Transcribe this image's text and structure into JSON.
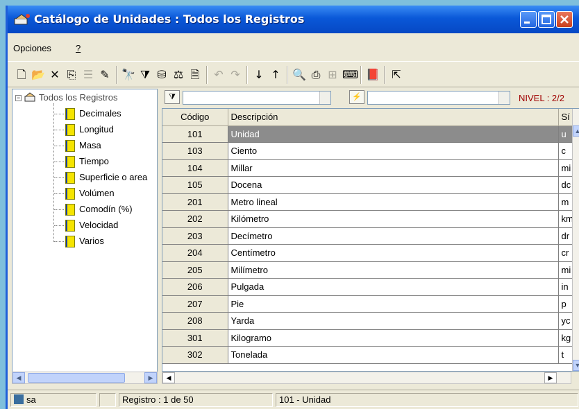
{
  "window": {
    "title": "Catálogo de Unidades  :   Todos los Registros"
  },
  "menu": {
    "items": [
      "Opciones",
      "?"
    ]
  },
  "toolbar": {
    "tools": [
      {
        "name": "new-icon",
        "glyph": "🗋"
      },
      {
        "name": "open-folder-icon",
        "glyph": "📂"
      },
      {
        "name": "delete-icon",
        "glyph": "✕"
      },
      {
        "name": "copy-icon",
        "glyph": "⎘"
      },
      {
        "name": "columns-icon",
        "glyph": "☰"
      },
      {
        "name": "edit-icon",
        "glyph": "✎"
      },
      {
        "name": "find-icon",
        "glyph": "🔭"
      },
      {
        "name": "filter-icon",
        "glyph": "⧩"
      },
      {
        "name": "group-icon",
        "glyph": "⛁"
      },
      {
        "name": "units-icon",
        "glyph": "⚖"
      },
      {
        "name": "properties-icon",
        "glyph": "🗎"
      },
      {
        "name": "undo-icon",
        "glyph": "↶"
      },
      {
        "name": "redo-icon",
        "glyph": "↷"
      },
      {
        "name": "sort-ascending-icon",
        "glyph": "↓"
      },
      {
        "name": "sort-descending-icon",
        "glyph": "↑"
      },
      {
        "name": "print-preview-icon",
        "glyph": "🔍"
      },
      {
        "name": "print-icon",
        "glyph": "⎙"
      },
      {
        "name": "hierarchy-icon",
        "glyph": "⊞"
      },
      {
        "name": "keyboard-icon",
        "glyph": "⌨"
      },
      {
        "name": "book-icon",
        "glyph": "📕"
      },
      {
        "name": "exit-icon",
        "glyph": "⇱"
      }
    ]
  },
  "tree": {
    "root": "Todos los Registros",
    "items": [
      "Decimales",
      "Longitud",
      "Masa",
      "Tiempo",
      "Superficie o area",
      "Volúmen",
      "Comodín (%)",
      "Velocidad",
      "Varios"
    ]
  },
  "filter": {
    "nivel": "NIVEL : 2/2"
  },
  "grid": {
    "headers": {
      "code": "Código",
      "desc": "Descripción",
      "sym": "Sí"
    },
    "rows": [
      {
        "code": "101",
        "desc": "Unidad",
        "sym": "u"
      },
      {
        "code": "103",
        "desc": "Ciento",
        "sym": "c"
      },
      {
        "code": "104",
        "desc": "Millar",
        "sym": "mi"
      },
      {
        "code": "105",
        "desc": "Docena",
        "sym": "dc"
      },
      {
        "code": "201",
        "desc": "Metro lineal",
        "sym": "m"
      },
      {
        "code": "202",
        "desc": "Kilómetro",
        "sym": "km"
      },
      {
        "code": "203",
        "desc": "Decímetro",
        "sym": "dr"
      },
      {
        "code": "204",
        "desc": "Centímetro",
        "sym": "cr"
      },
      {
        "code": "205",
        "desc": "Milímetro",
        "sym": "mi"
      },
      {
        "code": "206",
        "desc": "Pulgada",
        "sym": "in"
      },
      {
        "code": "207",
        "desc": "Pie",
        "sym": "p"
      },
      {
        "code": "208",
        "desc": "Yarda",
        "sym": "yc"
      },
      {
        "code": "301",
        "desc": "Kilogramo",
        "sym": "kg"
      },
      {
        "code": "302",
        "desc": "Tonelada",
        "sym": "t"
      }
    ],
    "selected_row": 0
  },
  "status": {
    "user": "sa",
    "registro": "Registro :  1 de  50",
    "current": "101 - Unidad"
  }
}
